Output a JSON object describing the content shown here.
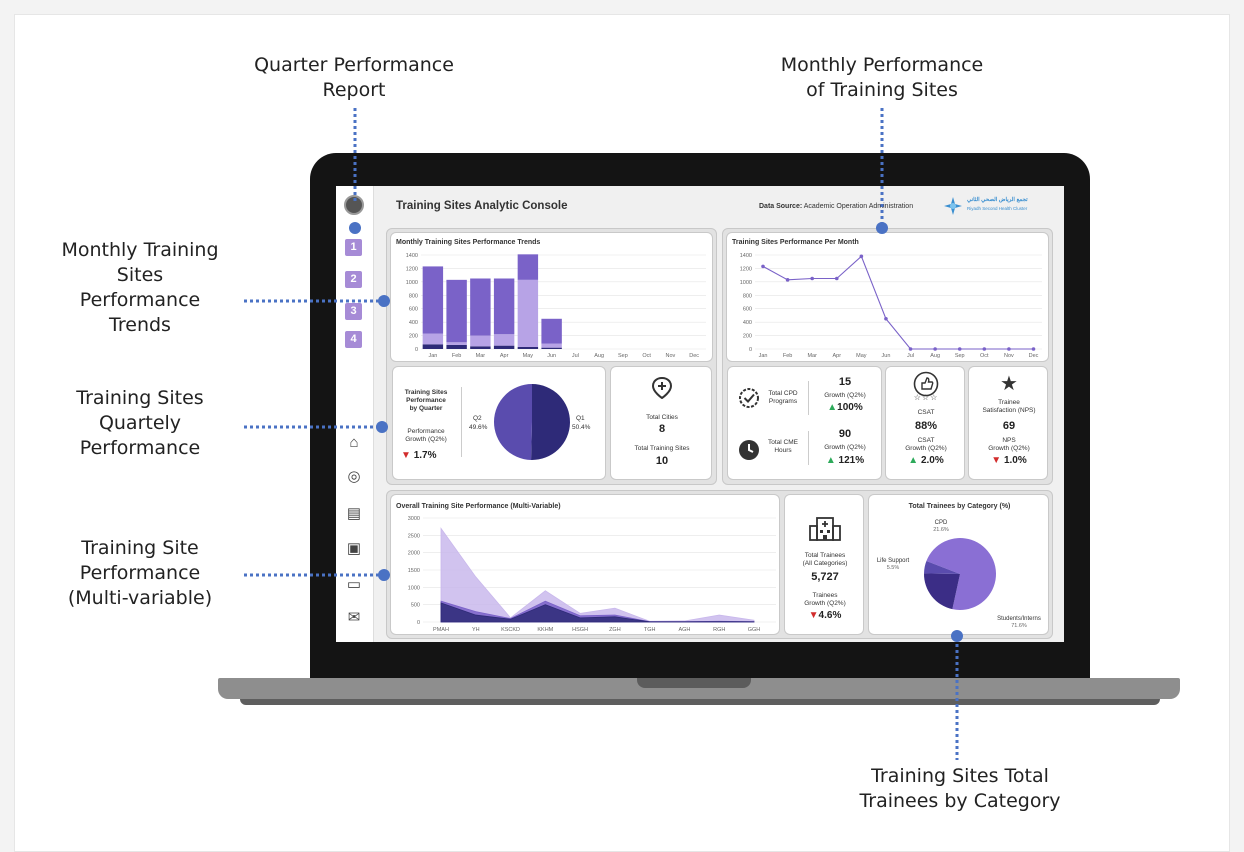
{
  "callouts": {
    "quarter_report": "Quarter Performance\nReport",
    "monthly_performance": "Monthly Performance\nof Training Sites",
    "monthly_trends": "Monthly Training\nSites\nPerformance\nTrends",
    "quarterly_performance": "Training Sites\nQuartely\nPerformance",
    "multi_variable": "Training Site\nPerformance\n(Multi-variable)",
    "total_trainees": "Training Sites Total\nTrainees by Category"
  },
  "sidebar": {
    "quarters": [
      "1",
      "2",
      "3",
      "4"
    ],
    "icons": [
      "home-icon",
      "target-icon",
      "report-icon",
      "contact-book-icon",
      "chat-icon",
      "mail-icon"
    ]
  },
  "header": {
    "title": "Training Sites Analytic Console",
    "source_label": "Data Source:",
    "source_value": "Academic Operation Administration",
    "logo_arabic": "تجمع الرياض الصحي الثاني",
    "logo_english": "Riyadh Second Health Cluster"
  },
  "colors": {
    "purple_dark": "#2e2a78",
    "purple_mid": "#7a62c8",
    "purple_light": "#b7a3e6",
    "green": "#2daa5a",
    "red": "#d22c2c"
  },
  "cards": {
    "quarter": {
      "title": "Training Sites\nPerformance\nby Quarter",
      "growth_label": "Performance\nGrowth (Q2%)",
      "growth_value": "1.7%",
      "growth_dir": "down",
      "q2_label": "Q2",
      "q2_pct": "49.6%",
      "q1_label": "Q1",
      "q1_pct": "50.4%"
    },
    "cities": {
      "cities_label": "Total Cities",
      "cities_value": "8",
      "sites_label": "Total Training Sites",
      "sites_value": "10"
    },
    "cpd": {
      "cpd_label": "Total CPD\nPrograms",
      "cpd_value": "15",
      "cpd_growth_label": "Growth (Q2%)",
      "cpd_growth": "100%",
      "cme_label": "Total CME\nHours",
      "cme_value": "90",
      "cme_growth_label": "Growth (Q2%)",
      "cme_growth": "121%"
    },
    "csat": {
      "label": "CSAT",
      "value": "88%",
      "growth_label": "CSAT\nGrowth (Q2%)",
      "growth": "2.0%"
    },
    "nps": {
      "label": "Trainee\nSatisfaction (NPS)",
      "value": "69",
      "growth_label": "NPS\nGrowth (Q2%)",
      "growth": "1.0%"
    },
    "trainees": {
      "label": "Total Trainees\n(All Categories)",
      "value": "5,727",
      "growth_label": "Trainees\nGrowth (Q2%)",
      "growth": "4.6%"
    }
  },
  "chart_data": [
    {
      "type": "bar",
      "title": "Monthly Training Sites Performance Trends",
      "stacked": true,
      "categories": [
        "Jan",
        "Feb",
        "Mar",
        "Apr",
        "May",
        "Jun",
        "Jul",
        "Aug",
        "Sep",
        "Oct",
        "Nov",
        "Dec"
      ],
      "series": [
        {
          "color": "#2e2a78",
          "values": [
            70,
            60,
            40,
            50,
            30,
            20,
            0,
            0,
            0,
            0,
            0,
            0
          ]
        },
        {
          "color": "#b7a3e6",
          "values": [
            160,
            40,
            160,
            170,
            1000,
            60,
            0,
            0,
            0,
            0,
            0,
            0
          ]
        },
        {
          "color": "#7a62c8",
          "values": [
            1000,
            930,
            850,
            830,
            380,
            370,
            0,
            0,
            0,
            0,
            0,
            0
          ]
        }
      ],
      "ylim": [
        0,
        1400
      ],
      "yticks": [
        0,
        200,
        400,
        600,
        800,
        1000,
        1200,
        1400
      ]
    },
    {
      "type": "line",
      "title": "Training Sites Performance Per Month",
      "categories": [
        "Jan",
        "Feb",
        "Mar",
        "Apr",
        "May",
        "Jun",
        "Jul",
        "Aug",
        "Sep",
        "Oct",
        "Nov",
        "Dec"
      ],
      "values": [
        1230,
        1030,
        1050,
        1050,
        1380,
        450,
        0,
        0,
        0,
        0,
        0,
        0
      ],
      "ylim": [
        0,
        1400
      ],
      "yticks": [
        0,
        200,
        400,
        600,
        800,
        1000,
        1200,
        1400
      ]
    },
    {
      "type": "pie",
      "labels": [
        "Q1",
        "Q2"
      ],
      "values": [
        50.4,
        49.6
      ]
    },
    {
      "type": "area",
      "title": "Overall Training Site Performance (Multi-Variable)",
      "categories": [
        "PMAH",
        "YH",
        "KSCKD",
        "KKHM",
        "HSGH",
        "ZGH",
        "TGH",
        "AGH",
        "RGH",
        "GGH"
      ],
      "series": [
        {
          "color": "#c9b8ec",
          "values": [
            2700,
            1300,
            120,
            900,
            250,
            400,
            20,
            30,
            200,
            50
          ]
        },
        {
          "color": "#7a62c8",
          "values": [
            600,
            300,
            100,
            600,
            180,
            200,
            10,
            10,
            20,
            10
          ]
        },
        {
          "color": "#2e2a78",
          "values": [
            550,
            200,
            80,
            500,
            120,
            150,
            5,
            5,
            10,
            5
          ]
        }
      ],
      "ylim": [
        0,
        3000
      ],
      "yticks": [
        0,
        500,
        1000,
        1500,
        2000,
        2500,
        3000
      ]
    },
    {
      "type": "pie",
      "title": "Total Trainees by Category (%)",
      "labels": [
        "Students/Interns",
        "CPD",
        "Life Support"
      ],
      "values": [
        71.6,
        21.6,
        5.5
      ],
      "percent_labels": [
        "71.6%",
        "21.6%",
        "5.5%"
      ]
    }
  ]
}
